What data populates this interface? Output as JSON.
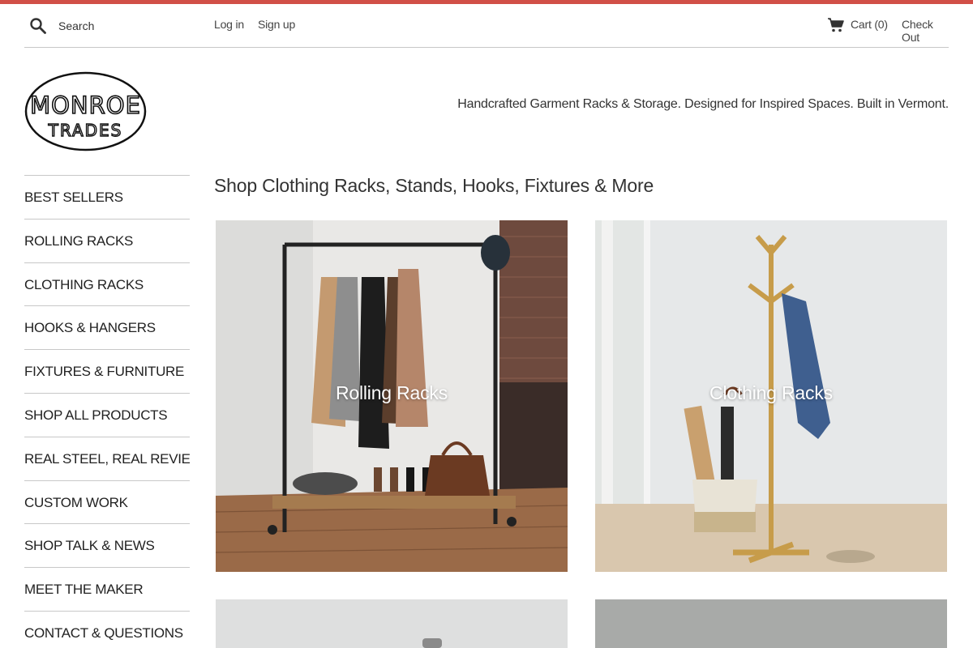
{
  "brand": {
    "accent": "#d14f47",
    "logo_line1": "MONROE",
    "logo_line2": "TRADES"
  },
  "topbar": {
    "search_placeholder": "Search",
    "login": "Log in",
    "signup": "Sign up",
    "cart": "Cart (0)",
    "checkout": "Check Out"
  },
  "header": {
    "tagline": "Handcrafted Garment Racks & Storage. Designed for Inspired Spaces. Built in Vermont."
  },
  "sidebar": {
    "items": [
      {
        "label": "BEST SELLERS"
      },
      {
        "label": "ROLLING RACKS"
      },
      {
        "label": "CLOTHING RACKS"
      },
      {
        "label": "HOOKS & HANGERS"
      },
      {
        "label": "FIXTURES & FURNITURE"
      },
      {
        "label": "SHOP ALL PRODUCTS"
      },
      {
        "label": "REAL STEEL, REAL REVIEWS"
      },
      {
        "label": "CUSTOM WORK"
      },
      {
        "label": "SHOP TALK & NEWS"
      },
      {
        "label": "MEET THE MAKER"
      },
      {
        "label": "CONTACT & QUESTIONS"
      }
    ]
  },
  "main": {
    "title": "Shop Clothing Racks, Stands, Hooks, Fixtures & More",
    "collections": [
      {
        "label": "Rolling Racks"
      },
      {
        "label": "Clothing Racks"
      },
      {
        "label": ""
      },
      {
        "label": ""
      }
    ]
  }
}
